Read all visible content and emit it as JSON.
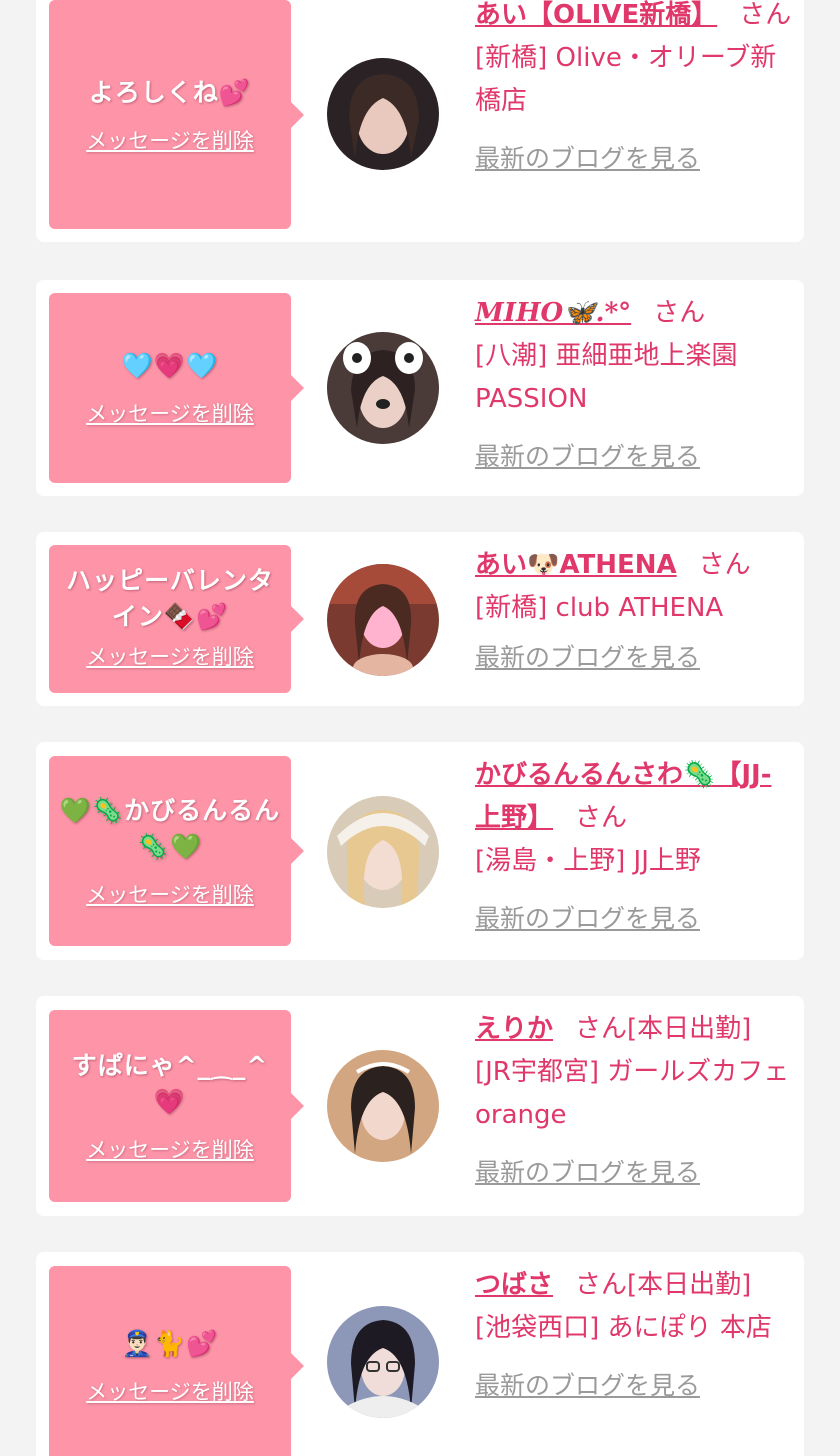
{
  "delete_label": "メッセージを削除",
  "blog_label": "最新のブログを見る",
  "san_label": "さん",
  "colors": {
    "page_bg": "#f3f3f3",
    "card_bg": "#ffffff",
    "bubble_bg": "#fd94a8",
    "accent": "#e0386b",
    "muted": "#9a9a9a"
  },
  "cards": [
    {
      "message": "よろしくね💕",
      "name": "あい【OLIVE新橋】",
      "status": "",
      "shop": "[新橋] Olive・オリーブ新橋店",
      "avatar_icon": "profile-photo"
    },
    {
      "message": "🩵💗🩵",
      "name": "MIHO🦋.*°",
      "status": "",
      "shop": "[八潮] 亜細亜地上楽園PASSION",
      "avatar_icon": "profile-photo"
    },
    {
      "message": "ハッピーバレンタイン🍫💕",
      "name": "あい🐶ATHENA",
      "status": "",
      "shop": "[新橋] club ATHENA",
      "avatar_icon": "profile-photo"
    },
    {
      "message": "💚🦠かびるんるん🦠💚",
      "name": "かびるんるんさわ🦠【JJ-上野】",
      "status": "",
      "shop": "[湯島・上野] JJ上野",
      "avatar_icon": "profile-photo"
    },
    {
      "message": "すぱにゃ^_⁔_^💗",
      "name": "えりか",
      "status": "[本日出勤]",
      "shop": "[JR宇都宮] ガールズカフェ orange",
      "avatar_icon": "profile-photo"
    },
    {
      "message": "👮🏻‍♂️🐈💕",
      "name": "つばさ",
      "status": "[本日出勤]",
      "shop": "[池袋西口] あにぽり 本店",
      "avatar_icon": "profile-photo"
    }
  ]
}
